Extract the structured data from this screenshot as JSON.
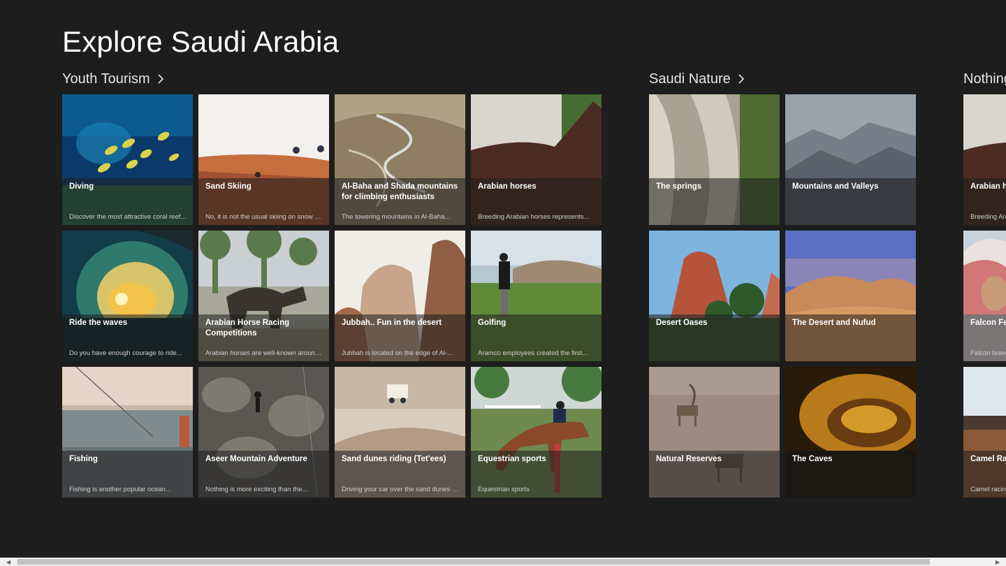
{
  "page": {
    "title": "Explore Saudi Arabia"
  },
  "sections": [
    {
      "title": "Youth Tourism",
      "tiles": [
        {
          "title": "Diving",
          "desc": "Discover the most attractive coral reefs...",
          "icon": "diving-image"
        },
        {
          "title": "Ride the waves",
          "desc": "Do you have enough courage to ride...",
          "icon": "waves-image"
        },
        {
          "title": "Fishing",
          "desc": "Fishing is another popular ocean...",
          "icon": "fishing-image"
        },
        {
          "title": "Sand Skiing",
          "desc": "No, it is not the usual skiing on snow or...",
          "icon": "sand-skiing-image"
        },
        {
          "title": "Arabian Horse Racing Competitions",
          "desc": "Arabian horses are well-known around...",
          "icon": "horse-racing-image"
        },
        {
          "title": "Aseer Mountain Adventure",
          "desc": "Nothing is more exciting than the...",
          "icon": "climbing-image"
        },
        {
          "title": "Al-Baha and Shada mountains for climbing enthusiasts",
          "desc": "The towering mountains in Al-Baha...",
          "icon": "mountain-road-image"
        },
        {
          "title": "Jubbah.. Fun in the desert",
          "desc": "Jubbah is located on the edge of Al-...",
          "icon": "rock-formation-image"
        },
        {
          "title": "Sand dunes riding (Tet'ees)",
          "desc": "Driving your car over the sand dunes is...",
          "icon": "dune-driving-image"
        },
        {
          "title": "Arabian horses",
          "desc": "Breeding Arabian horses represents...",
          "icon": "arabian-horse-image"
        },
        {
          "title": "Golfing",
          "desc": "Aramco employees created the first...",
          "icon": "golf-image"
        },
        {
          "title": "Equestrian sports",
          "desc": "Equestrian sports",
          "icon": "show-jumping-image"
        }
      ]
    },
    {
      "title": "Saudi Nature",
      "tiles": [
        {
          "title": "The springs",
          "desc": "",
          "icon": "springs-image"
        },
        {
          "title": "Desert Oases",
          "desc": "",
          "icon": "oasis-image"
        },
        {
          "title": "Natural Reserves",
          "desc": "",
          "icon": "ibex-image"
        },
        {
          "title": "Mountains and Valleys",
          "desc": "",
          "icon": "mountains-image"
        },
        {
          "title": "The Desert and Nufud",
          "desc": "",
          "icon": "desert-image"
        },
        {
          "title": "The Caves",
          "desc": "",
          "icon": "cave-image"
        }
      ]
    },
    {
      "title": "Nothing",
      "tiles": [
        {
          "title": "Arabian h",
          "desc": "Breeding Ara",
          "icon": "arabian-horse-image",
          "selected": true
        },
        {
          "title": "Falcon Fes",
          "desc": "Falcon breed",
          "icon": "falcon-festival-image"
        },
        {
          "title": "Camel Rac",
          "desc": "Camel racing",
          "icon": "camel-race-image"
        }
      ]
    }
  ],
  "scrollbar": {
    "left_arrow": "◀",
    "right_arrow": "▶"
  }
}
